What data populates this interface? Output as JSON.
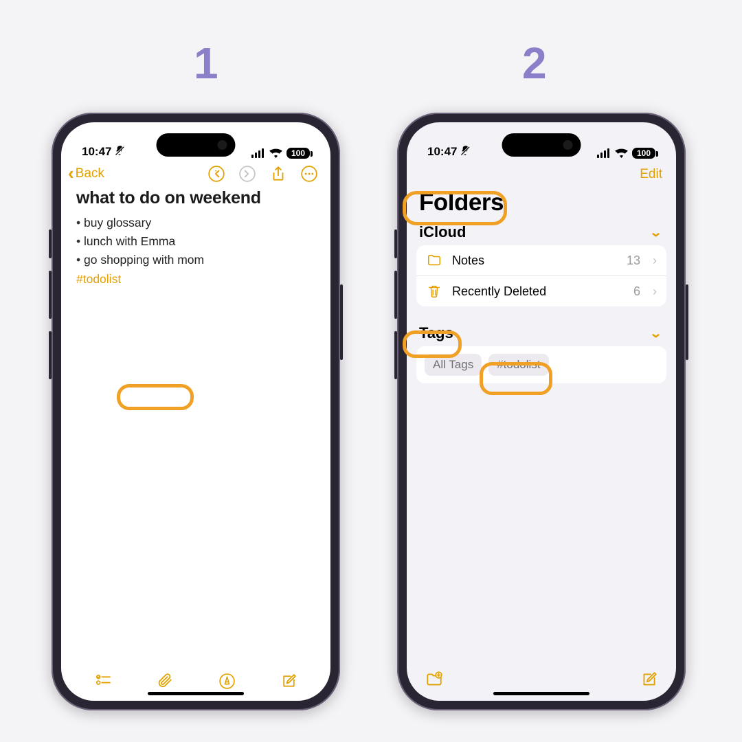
{
  "steps": {
    "s1": "1",
    "s2": "2"
  },
  "status": {
    "time": "10:47",
    "battery": "100"
  },
  "screen1": {
    "back_label": "Back",
    "note_title": "what to do on weekend",
    "bullets": [
      "buy glossary",
      "lunch with Emma",
      "go shopping with mom"
    ],
    "tag": "#todolist"
  },
  "screen2": {
    "edit_label": "Edit",
    "title": "Folders",
    "group": "iCloud",
    "folders": [
      {
        "icon": "folder",
        "label": "Notes",
        "count": "13"
      },
      {
        "icon": "trash",
        "label": "Recently Deleted",
        "count": "6"
      }
    ],
    "tags_header": "Tags",
    "tags": [
      "All Tags",
      "#todolist"
    ]
  }
}
